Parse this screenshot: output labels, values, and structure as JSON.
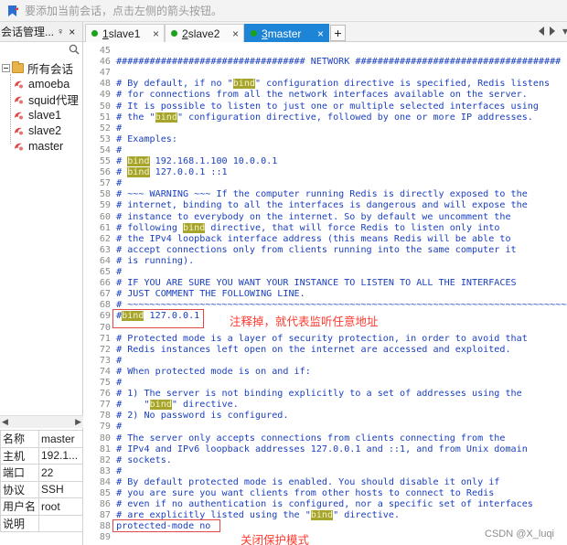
{
  "hint_bar": {
    "text": "要添加当前会话，点击左侧的箭头按钮。"
  },
  "session_pane": {
    "title": "会话管理...",
    "pin_glyph": "♀",
    "close_glyph": "×",
    "root_label": "所有会话",
    "sessions": [
      "amoeba",
      "squid代理",
      "slave1",
      "slave2",
      "master"
    ],
    "properties": [
      {
        "key": "名称",
        "value": "master"
      },
      {
        "key": "主机",
        "value": "192.1..."
      },
      {
        "key": "端口",
        "value": "22"
      },
      {
        "key": "协议",
        "value": "SSH"
      },
      {
        "key": "用户名",
        "value": "root"
      },
      {
        "key": "说明",
        "value": ""
      }
    ]
  },
  "tabs": [
    {
      "num": "1",
      "name": " slave1",
      "active": false
    },
    {
      "num": "2",
      "name": " slave2",
      "active": false
    },
    {
      "num": "3",
      "name": " master",
      "active": true
    }
  ],
  "tab_add": "+",
  "tab_menu": "▾",
  "terminal": {
    "lines": [
      {
        "n": "45",
        "parts": []
      },
      {
        "n": "46",
        "parts": [
          {
            "t": "################################## NETWORK #####################################"
          }
        ]
      },
      {
        "n": "47",
        "parts": []
      },
      {
        "n": "48",
        "parts": [
          {
            "t": "# By default, if no \""
          },
          {
            "t": "bind",
            "hl": true
          },
          {
            "t": "\" configuration directive is specified, Redis listens"
          }
        ]
      },
      {
        "n": "49",
        "parts": [
          {
            "t": "# for connections from all the network interfaces available on the server."
          }
        ]
      },
      {
        "n": "50",
        "parts": [
          {
            "t": "# It is possible to listen to just one or multiple selected interfaces using"
          }
        ]
      },
      {
        "n": "51",
        "parts": [
          {
            "t": "# the \""
          },
          {
            "t": "bind",
            "hl": true
          },
          {
            "t": "\" configuration directive, followed by one or more IP addresses."
          }
        ]
      },
      {
        "n": "52",
        "parts": [
          {
            "t": "#"
          }
        ]
      },
      {
        "n": "53",
        "parts": [
          {
            "t": "# Examples:"
          }
        ]
      },
      {
        "n": "54",
        "parts": [
          {
            "t": "#"
          }
        ]
      },
      {
        "n": "55",
        "parts": [
          {
            "t": "# "
          },
          {
            "t": "bind",
            "hl": true
          },
          {
            "t": " 192.168.1.100 10.0.0.1"
          }
        ]
      },
      {
        "n": "56",
        "parts": [
          {
            "t": "# "
          },
          {
            "t": "bind",
            "hl": true
          },
          {
            "t": " 127.0.0.1 ::1"
          }
        ]
      },
      {
        "n": "57",
        "parts": [
          {
            "t": "#"
          }
        ]
      },
      {
        "n": "58",
        "parts": [
          {
            "t": "# ~~~ WARNING ~~~ If the computer running Redis is directly exposed to the"
          }
        ]
      },
      {
        "n": "59",
        "parts": [
          {
            "t": "# internet, binding to all the interfaces is dangerous and will expose the"
          }
        ]
      },
      {
        "n": "60",
        "parts": [
          {
            "t": "# instance to everybody on the internet. So by default we uncomment the"
          }
        ]
      },
      {
        "n": "61",
        "parts": [
          {
            "t": "# following "
          },
          {
            "t": "bind",
            "hl": true
          },
          {
            "t": " directive, that will force Redis to listen only into"
          }
        ]
      },
      {
        "n": "62",
        "parts": [
          {
            "t": "# the IPv4 loopback interface address (this means Redis will be able to"
          }
        ]
      },
      {
        "n": "63",
        "parts": [
          {
            "t": "# accept connections only from clients running into the same computer it"
          }
        ]
      },
      {
        "n": "64",
        "parts": [
          {
            "t": "# is running)."
          }
        ]
      },
      {
        "n": "65",
        "parts": [
          {
            "t": "#"
          }
        ]
      },
      {
        "n": "66",
        "parts": [
          {
            "t": "# IF YOU ARE SURE YOU WANT YOUR INSTANCE TO LISTEN TO ALL THE INTERFACES"
          }
        ]
      },
      {
        "n": "67",
        "parts": [
          {
            "t": "# JUST COMMENT THE FOLLOWING LINE."
          }
        ]
      },
      {
        "n": "68",
        "parts": [
          {
            "t": "# ~~~~~~~~~~~~~~~~~~~~~~~~~~~~~~~~~~~~~~~~~~~~~~~~~~~~~~~~~~~~~~~~~~~~~~~~~~~~~~~~"
          }
        ]
      },
      {
        "n": "69",
        "parts": [
          {
            "t": "#"
          },
          {
            "t": "bind",
            "hl": true
          },
          {
            "t": " 127.0.0.1"
          }
        ]
      },
      {
        "n": "70",
        "parts": []
      },
      {
        "n": "71",
        "parts": [
          {
            "t": "# Protected mode is a layer of security protection, in order to avoid that"
          }
        ]
      },
      {
        "n": "72",
        "parts": [
          {
            "t": "# Redis instances left open on the internet are accessed and exploited."
          }
        ]
      },
      {
        "n": "73",
        "parts": [
          {
            "t": "#"
          }
        ]
      },
      {
        "n": "74",
        "parts": [
          {
            "t": "# When protected mode is on and if:"
          }
        ]
      },
      {
        "n": "75",
        "parts": [
          {
            "t": "#"
          }
        ]
      },
      {
        "n": "76",
        "parts": [
          {
            "t": "# 1) The server is not binding explicitly to a set of addresses using the"
          }
        ]
      },
      {
        "n": "77",
        "parts": [
          {
            "t": "#    \""
          },
          {
            "t": "bind",
            "hl": true
          },
          {
            "t": "\" directive."
          }
        ]
      },
      {
        "n": "78",
        "parts": [
          {
            "t": "# 2) No password is configured."
          }
        ]
      },
      {
        "n": "79",
        "parts": [
          {
            "t": "#"
          }
        ]
      },
      {
        "n": "80",
        "parts": [
          {
            "t": "# The server only accepts connections from clients connecting from the"
          }
        ]
      },
      {
        "n": "81",
        "parts": [
          {
            "t": "# IPv4 and IPv6 loopback addresses 127.0.0.1 and ::1, and from Unix domain"
          }
        ]
      },
      {
        "n": "82",
        "parts": [
          {
            "t": "# sockets."
          }
        ]
      },
      {
        "n": "83",
        "parts": [
          {
            "t": "#"
          }
        ]
      },
      {
        "n": "84",
        "parts": [
          {
            "t": "# By default protected mode is enabled. You should disable it only if"
          }
        ]
      },
      {
        "n": "85",
        "parts": [
          {
            "t": "# you are sure you want clients from other hosts to connect to Redis"
          }
        ]
      },
      {
        "n": "86",
        "parts": [
          {
            "t": "# even if no authentication is configured, nor a specific set of interfaces"
          }
        ]
      },
      {
        "n": "87",
        "parts": [
          {
            "t": "# are explicitly listed using the \""
          },
          {
            "t": "bind",
            "hl": true
          },
          {
            "t": "\" directive."
          }
        ]
      },
      {
        "n": "88",
        "parts": [
          {
            "t": "protected-mode no"
          }
        ]
      },
      {
        "n": "89",
        "parts": []
      }
    ],
    "annotation_bind": "注释掉，就代表监听任意地址",
    "annotation_protected": "关闭保护模式"
  },
  "watermark": "CSDN @X_luqi",
  "colors": {
    "tab_active": "#1d84d6",
    "highlight": "#a6a42a",
    "annotation": "#ff3b30",
    "code": "#1a3fbf"
  }
}
